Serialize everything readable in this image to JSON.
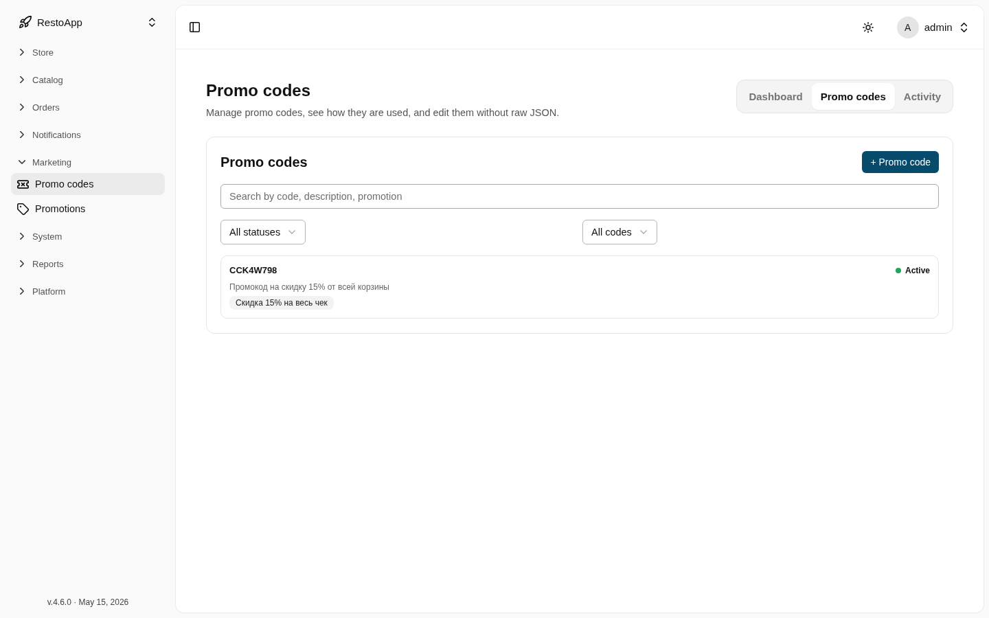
{
  "sidebar": {
    "app_name": "RestoApp",
    "sections": [
      {
        "label": "Store",
        "expanded": false
      },
      {
        "label": "Catalog",
        "expanded": false
      },
      {
        "label": "Orders",
        "expanded": false
      },
      {
        "label": "Notifications",
        "expanded": false
      },
      {
        "label": "Marketing",
        "expanded": true,
        "children": [
          {
            "label": "Promo codes",
            "selected": true
          },
          {
            "label": "Promotions",
            "selected": false
          }
        ]
      },
      {
        "label": "System",
        "expanded": false
      },
      {
        "label": "Reports",
        "expanded": false
      },
      {
        "label": "Platform",
        "expanded": false
      }
    ],
    "version": "v.4.6.0 · May 15, 2026"
  },
  "top_bar": {
    "user": {
      "avatar_initial": "A",
      "name": "admin"
    }
  },
  "page": {
    "title": "Promo codes",
    "subtitle": "Manage promo codes, see how they are used, and edit them without raw JSON.",
    "tabs": [
      {
        "label": "Dashboard",
        "selected": false
      },
      {
        "label": "Promo codes",
        "selected": true
      },
      {
        "label": "Activity",
        "selected": false
      }
    ]
  },
  "promo_codes_card": {
    "title": "Promo codes",
    "add_button": "+ Promo code",
    "search": {
      "placeholder": "Search by code, description, promotion"
    },
    "filters": [
      "All statuses",
      "All codes"
    ],
    "items": [
      {
        "code": "CCK4W798",
        "description": "Промокод на скидку 15% от всей корзины",
        "promotion": "Скидка 15% на весь чек",
        "status": "Active",
        "color": "#22a559"
      }
    ]
  }
}
